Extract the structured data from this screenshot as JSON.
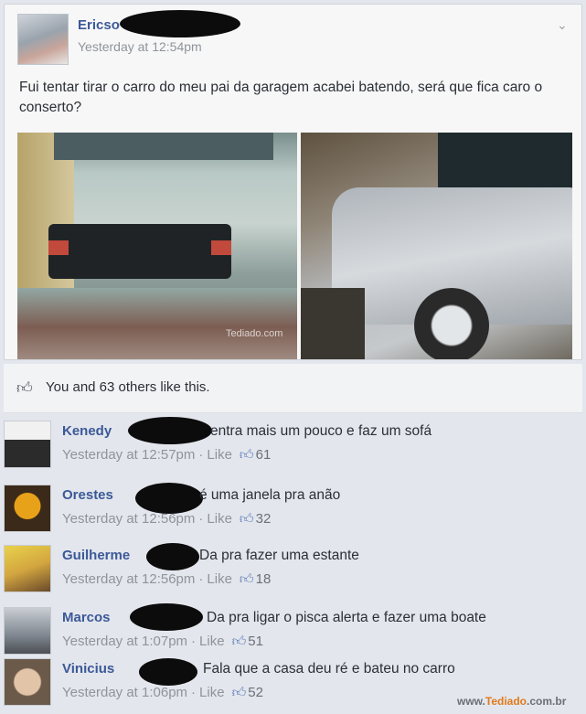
{
  "post": {
    "author": "Ericso",
    "time": "Yesterday at 12:54pm",
    "text": "Fui tentar tirar o carro do meu pai da garagem acabei batendo, será que fica caro o conserto?",
    "photo_watermark": "Tediado.com"
  },
  "likes": {
    "text": "You and 63 others like this."
  },
  "comments": [
    {
      "name": "Kenedy",
      "text": "entra mais um pouco e faz um sofá",
      "time": "Yesterday at 12:57pm",
      "like_label": "Like",
      "likes": "61"
    },
    {
      "name": "Orestes",
      "text": "é uma janela pra anão",
      "time": "Yesterday at 12:56pm",
      "like_label": "Like",
      "likes": "32"
    },
    {
      "name": "Guilherme",
      "text": "Da pra fazer uma estante",
      "time": "Yesterday at 12:56pm",
      "like_label": "Like",
      "likes": "18"
    },
    {
      "name": "Marcos",
      "text": "Da pra ligar o pisca alerta e fazer uma boate",
      "time": "Yesterday at 1:07pm",
      "like_label": "Like",
      "likes": "51"
    },
    {
      "name": "Vinicius",
      "text": "Fala que a casa deu ré e bateu no carro",
      "time": "Yesterday at 1:06pm",
      "like_label": "Like",
      "likes": "52"
    }
  ],
  "watermark": {
    "prefix": "www.",
    "brand": "Tediado",
    "suffix": ".com.br"
  },
  "icons": {
    "chevron": "chevron-down-icon",
    "like": "thumbs-up-icon"
  }
}
